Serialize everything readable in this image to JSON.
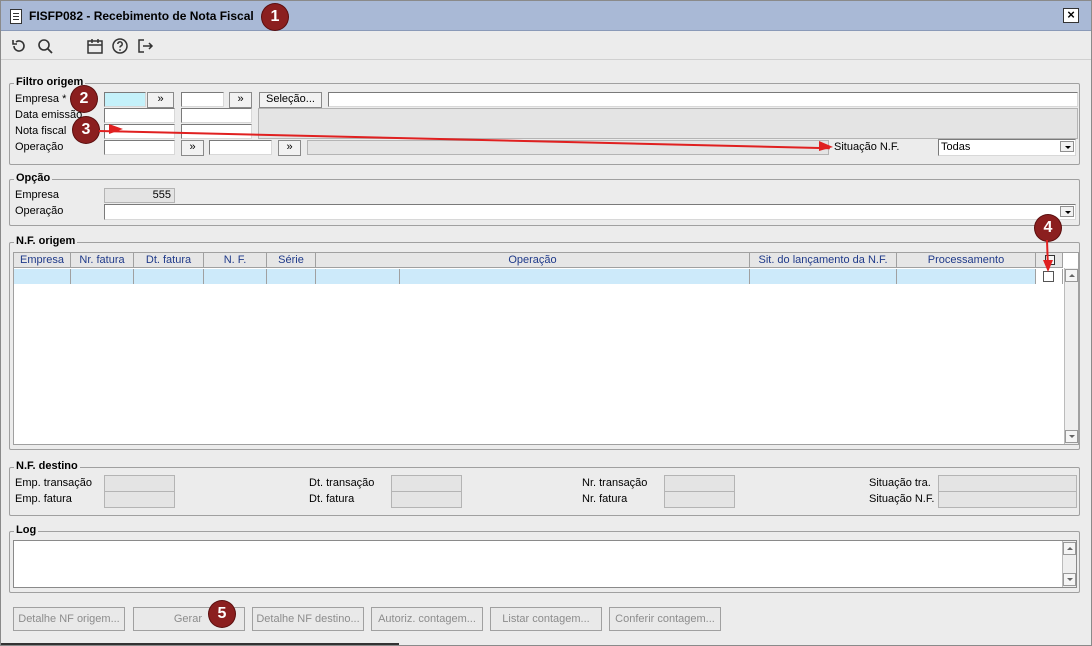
{
  "window": {
    "title": "FISFP082 - Recebimento de Nota Fiscal",
    "close": "×"
  },
  "markers": [
    "1",
    "2",
    "3",
    "4",
    "5"
  ],
  "toolbar": {
    "icons": [
      "refresh-icon",
      "search-icon",
      "calendar-icon",
      "help-icon",
      "exit-icon"
    ]
  },
  "filtro": {
    "title": "Filtro origem",
    "empresa_label": "Empresa *",
    "data_emissao_label": "Data emissão",
    "nota_fiscal_label": "Nota fiscal",
    "operacao_label": "Operação",
    "lookup_btn": "»",
    "selecao_btn": "Seleção...",
    "situacao_label": "Situação N.F.",
    "situacao_value": "Todas"
  },
  "opcao": {
    "title": "Opção",
    "empresa_label": "Empresa",
    "empresa_value": "555",
    "operacao_label": "Operação"
  },
  "nf_origem": {
    "title": "N.F. origem",
    "columns": [
      "Empresa",
      "Nr. fatura",
      "Dt. fatura",
      "N. F.",
      "Série",
      "Operação",
      "Sit. do lançamento da N.F.",
      "Processamento"
    ]
  },
  "nf_destino": {
    "title": "N.F. destino",
    "emp_transacao": "Emp. transação",
    "emp_fatura": "Emp. fatura",
    "dt_transacao": "Dt. transação",
    "dt_fatura": "Dt. fatura",
    "nr_transacao": "Nr. transação",
    "nr_fatura": "Nr. fatura",
    "situacao_tra": "Situação tra.",
    "situacao_nf": "Situação N.F."
  },
  "log": {
    "title": "Log"
  },
  "buttons": {
    "detalhe_origem": "Detalhe NF origem...",
    "gerar": "Gerar",
    "detalhe_destino": "Detalhe NF destino...",
    "autoriz": "Autoriz. contagem...",
    "listar": "Listar contagem...",
    "conferir": "Conferir contagem..."
  },
  "colors": {
    "titlebar": "#a9b9d6",
    "marker": "#8b1f1f",
    "highlight_input": "#c4f1fa",
    "grid_row": "#cdeafa",
    "header_text": "#1f3a8a",
    "arrow": "#e02020"
  }
}
